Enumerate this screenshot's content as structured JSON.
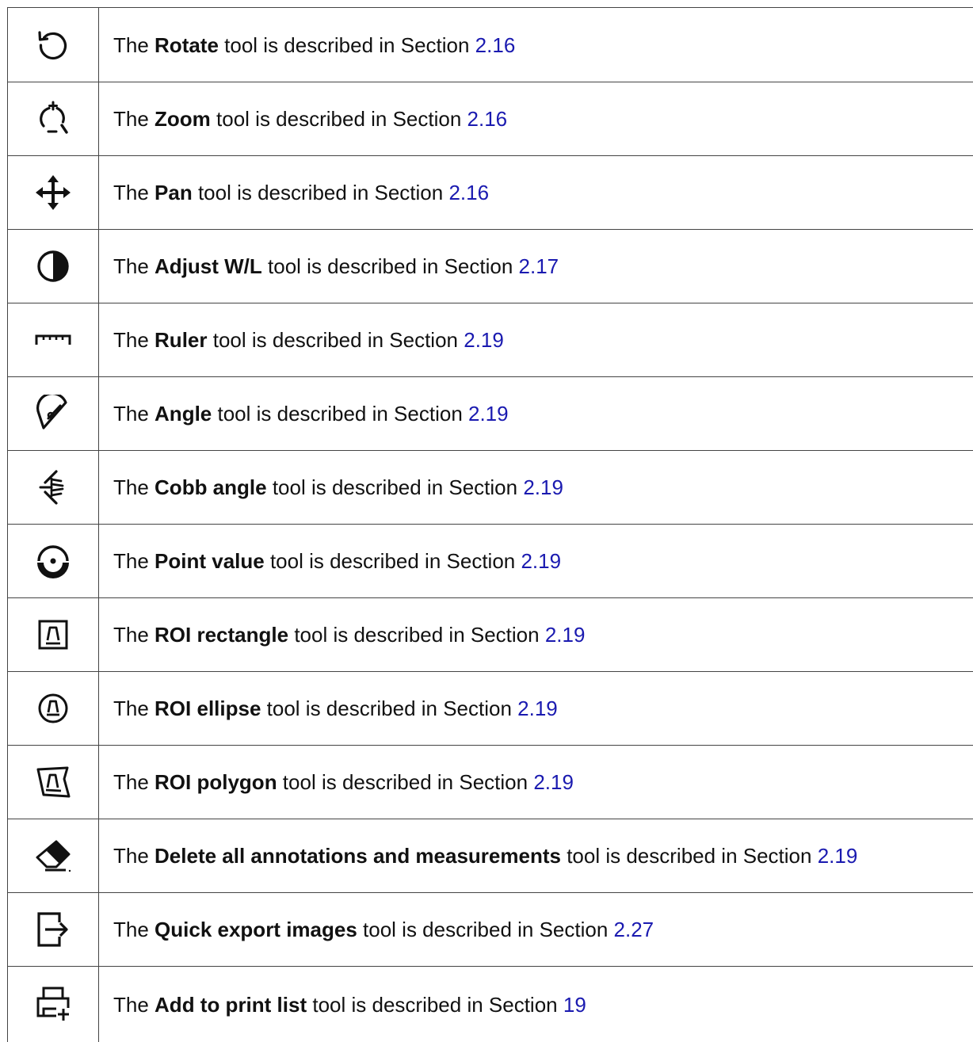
{
  "rows": [
    {
      "icon": "rotate-icon",
      "prefix": "The ",
      "tool": "Rotate",
      "middle": " tool is described in Section ",
      "ref": "2.16"
    },
    {
      "icon": "zoom-icon",
      "prefix": "The ",
      "tool": "Zoom",
      "middle": " tool is described in Section ",
      "ref": "2.16"
    },
    {
      "icon": "pan-icon",
      "prefix": "The ",
      "tool": "Pan",
      "middle": " tool is described in Section ",
      "ref": "2.16"
    },
    {
      "icon": "adjust-wl-icon",
      "prefix": "The ",
      "tool": "Adjust W/L",
      "middle": " tool is described in Section ",
      "ref": "2.17"
    },
    {
      "icon": "ruler-icon",
      "prefix": "The ",
      "tool": "Ruler",
      "middle": " tool is described in Section ",
      "ref": "2.19"
    },
    {
      "icon": "angle-icon",
      "prefix": "The ",
      "tool": "Angle",
      "middle": " tool is described in Section ",
      "ref": "2.19"
    },
    {
      "icon": "cobb-angle-icon",
      "prefix": "The ",
      "tool": "Cobb angle",
      "middle": " tool is described in Section ",
      "ref": "2.19"
    },
    {
      "icon": "point-value-icon",
      "prefix": "The ",
      "tool": "Point value",
      "middle": " tool is described in Section ",
      "ref": "2.19"
    },
    {
      "icon": "roi-rectangle-icon",
      "prefix": "The ",
      "tool": "ROI rectangle",
      "middle": " tool is described in Section ",
      "ref": "2.19"
    },
    {
      "icon": "roi-ellipse-icon",
      "prefix": "The ",
      "tool": "ROI ellipse",
      "middle": " tool is described in Section ",
      "ref": "2.19"
    },
    {
      "icon": "roi-polygon-icon",
      "prefix": "The ",
      "tool": "ROI polygon",
      "middle": " tool is described in Section ",
      "ref": "2.19"
    },
    {
      "icon": "eraser-icon",
      "prefix": "The ",
      "tool": "Delete all annotations and measurements",
      "middle": " tool is described in Section ",
      "ref": "2.19"
    },
    {
      "icon": "export-icon",
      "prefix": "The ",
      "tool": "Quick export images",
      "middle": " tool is described in Section ",
      "ref": "2.27"
    },
    {
      "icon": "printer-add-icon",
      "prefix": "The ",
      "tool": "Add to print list",
      "middle": " tool is described in Section ",
      "ref": "19"
    }
  ],
  "colors": {
    "text": "#111111",
    "link": "#1a1ab0",
    "border": "#444444"
  }
}
